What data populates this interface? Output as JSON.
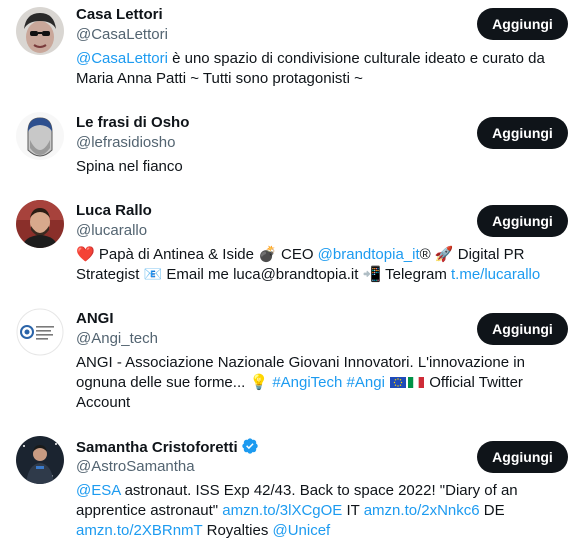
{
  "follow_label": "Aggiungi",
  "accounts": [
    {
      "name": "Casa Lettori",
      "handle": "@CasaLettori",
      "bio": [
        {
          "t": "@CasaLettori",
          "link": true
        },
        {
          "t": " è uno spazio di condivisione culturale ideato e curato da Maria Anna Patti ~ Tutti sono protagonisti ~"
        }
      ]
    },
    {
      "name": "Le frasi di Osho",
      "handle": "@lefrasidiosho",
      "bio": [
        {
          "t": "Spina nel fianco"
        }
      ]
    },
    {
      "name": "Luca Rallo",
      "handle": "@lucarallo",
      "bio": [
        {
          "t": "❤️",
          "emoji": "heart"
        },
        {
          "t": " Papà di Antinea & Iside "
        },
        {
          "t": "💣",
          "emoji": "bomb"
        },
        {
          "t": " CEO "
        },
        {
          "t": "@brandtopia_it",
          "link": true
        },
        {
          "t": "® "
        },
        {
          "t": "🚀",
          "emoji": "rocket"
        },
        {
          "t": " Digital PR Strategist "
        },
        {
          "t": "📧",
          "emoji": "envelope"
        },
        {
          "t": " Email me luca@brandtopia.it "
        },
        {
          "t": "📲",
          "emoji": "phone"
        },
        {
          "t": " Telegram "
        },
        {
          "t": "t.me/lucarallo",
          "link": true
        }
      ]
    },
    {
      "name": "ANGI",
      "handle": "@Angi_tech",
      "bio": [
        {
          "t": "ANGI - Associazione Nazionale Giovani Innovatori. L'innovazione in ognuna delle sue forme... "
        },
        {
          "t": "💡",
          "emoji": "bulb"
        },
        {
          "t": " "
        },
        {
          "t": "#AngiTech",
          "link": true
        },
        {
          "t": " "
        },
        {
          "t": "#Angi",
          "link": true
        },
        {
          "t": " "
        },
        {
          "t": "🇪🇺",
          "flag": "eu"
        },
        {
          "t": "🇮🇹",
          "flag": "it"
        },
        {
          "t": " Official Twitter Account"
        }
      ]
    },
    {
      "name": "Samantha Cristoforetti",
      "handle": "@AstroSamantha",
      "verified": true,
      "bio": [
        {
          "t": "@ESA",
          "link": true
        },
        {
          "t": " astronaut. ISS Exp 42/43. Back to space 2022! \"Diary of an apprentice astronaut\" "
        },
        {
          "t": "amzn.to/3lXCgOE",
          "link": true
        },
        {
          "t": " IT "
        },
        {
          "t": "amzn.to/2xNnkc6",
          "link": true
        },
        {
          "t": " DE "
        },
        {
          "t": "amzn.to/2XBRnmT",
          "link": true
        },
        {
          "t": " Royalties "
        },
        {
          "t": "@Unicef",
          "link": true
        }
      ]
    }
  ],
  "icons": {
    "verified": "verified-badge-icon",
    "colors": {
      "link": "#1d9bf0",
      "button": "#0f1419",
      "verified": "#1d9bf0"
    }
  }
}
